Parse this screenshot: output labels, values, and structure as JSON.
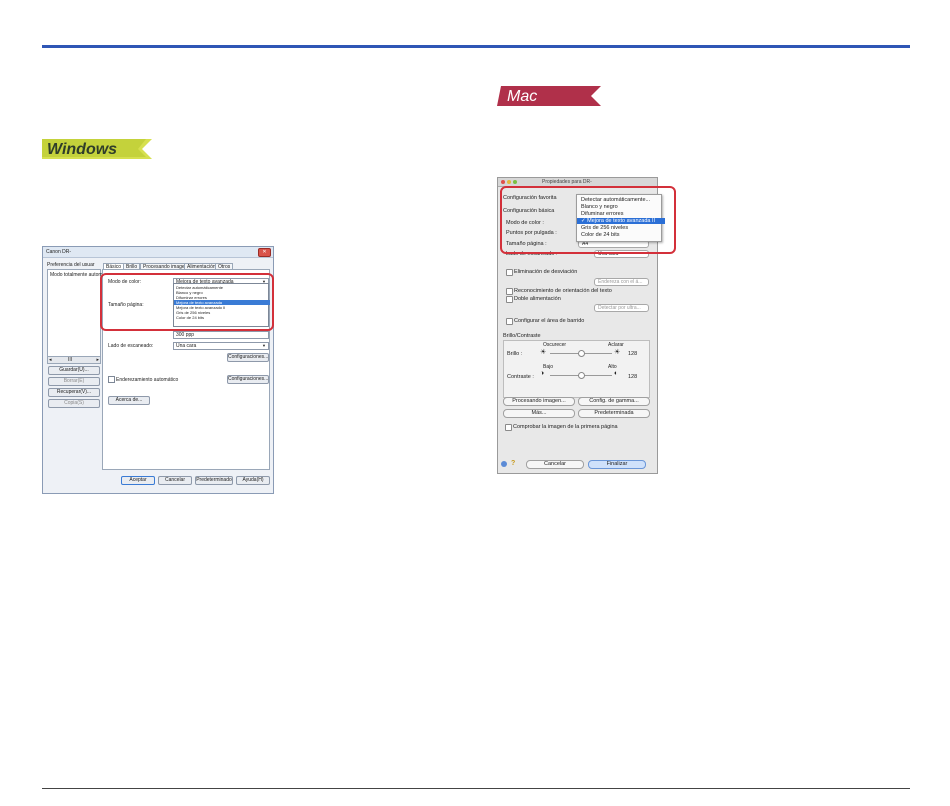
{
  "os_badges": {
    "windows": "Windows",
    "mac": "Mac"
  },
  "windows_dialog": {
    "title": "Canon DR-",
    "left_label": "Preferencia del usuar",
    "list_item": "Modo totalmente autom",
    "scroll_left": "◂",
    "scroll_thumb": "III",
    "scroll_right": "▸",
    "buttons_left": [
      "Guardar(U)...",
      "Borrar(E)",
      "Recuperar(V)...",
      "Copia(S)"
    ],
    "tabs": [
      "Básico",
      "Brillo",
      "Procesando imagen",
      "Alimentación",
      "Otros"
    ],
    "labels": {
      "color_mode": "Modo de color:",
      "page_size": "Tamaño página:",
      "scan_side": "Lado de escaneado:",
      "auto_straighten": "Enderezamiento automático"
    },
    "color_mode_value": "Mejora de texto avanzada",
    "dropdown_options": [
      "Detectar automáticamente",
      "Blanco y negro",
      "Difuminar errores",
      "Mejora de texto avanzada",
      "Mejora de texto avanzado II",
      "Gris de 256 niveles",
      "Color de 24 bits"
    ],
    "dropdown_selected_index": 3,
    "dpi_value": "300 ppp",
    "scan_side_value": "Una cara",
    "config_button_1": "Configuraciones...",
    "config_button_2": "Configuraciones...",
    "about_button": "Acerca de...",
    "bottom_buttons": [
      "Aceptar",
      "Cancelar",
      "Predeterminado",
      "Ayuda(H)"
    ]
  },
  "mac_dialog": {
    "title": "Propiedades para DR-",
    "labels": {
      "favorite": "Configuración favorita",
      "basic": "Configuración básica",
      "color_mode": "Modo de color :",
      "dpi": "Puntos por pulgada :",
      "page_size": "Tamaño página :",
      "scan_side": "Lado de escaneado :"
    },
    "popup_values": {
      "scan_side": "Una cara",
      "page_size": "A4"
    },
    "menu_options": [
      "Detectar automáticamente...",
      "Blanco y negro",
      "Difuminar errores",
      "Mejora de texto avanzada II",
      "Gris de 256 niveles",
      "Color de 24 bits"
    ],
    "menu_selected_index": 3,
    "checkmark": "✓",
    "checks": {
      "dropout": "Eliminación de desviación",
      "text_orientation": "Reconocimiento de orientación del texto",
      "double_feed": "Doble alimentación",
      "scan_area": "Configurar el área de barrido"
    },
    "straighten_popup": "Endereza con el á...",
    "detect_popup": "Detectar por ultra...",
    "brightness_section": "Brillo/Contraste",
    "brightness": {
      "label": "Brillo :",
      "low": "Oscurecer",
      "high": "Aclarar",
      "value": "128"
    },
    "contrast": {
      "label": "Contraste :",
      "low": "Bajo",
      "high": "Alto",
      "value": "128"
    },
    "buttons": {
      "image_processing": "Procesando imagen...",
      "gamma": "Config. de gamma...",
      "more": "Más...",
      "default": "Predeterminada",
      "cancel": "Cancelar",
      "finish": "Finalizar"
    },
    "check_first_page": "Comprobar la imagen de la primera página",
    "help": "?"
  },
  "colors": {
    "accent_rule": "#2f56b5",
    "highlight": "#d3303a",
    "mac_badge": "#b0304a",
    "windows_badge": "#c9d84a"
  }
}
